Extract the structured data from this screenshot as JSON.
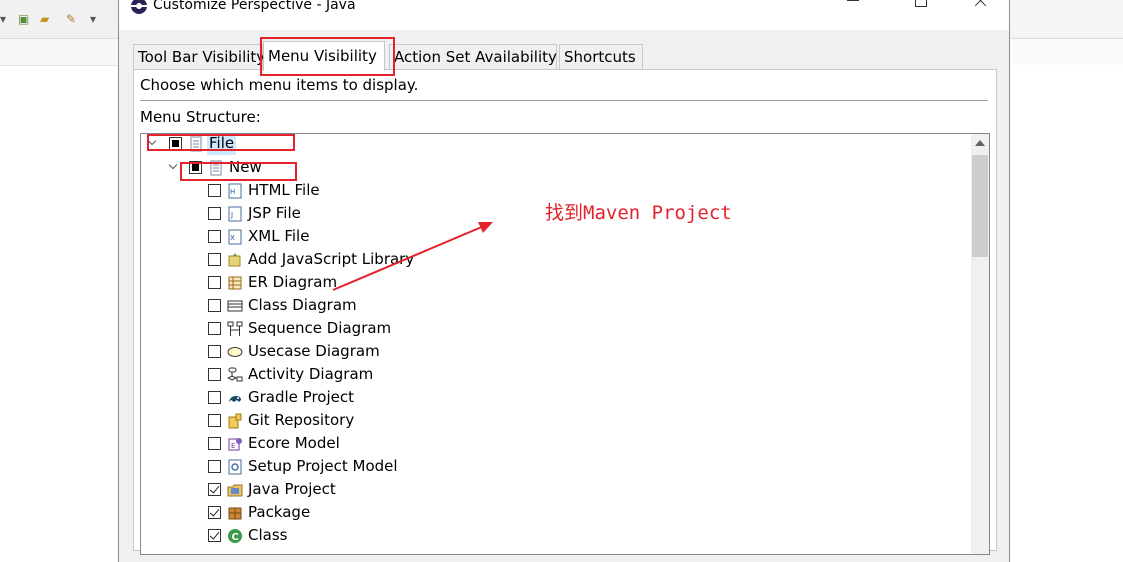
{
  "window": {
    "title": "Customize Perspective - Java"
  },
  "tabs": [
    {
      "label": "Tool Bar Visibility",
      "active": false
    },
    {
      "label": "Menu Visibility",
      "active": true
    },
    {
      "label": "Action Set Availability",
      "active": false
    },
    {
      "label": "Shortcuts",
      "active": false
    }
  ],
  "panel": {
    "description": "Choose which menu items to display.",
    "menu_structure_label": "Menu Structure:"
  },
  "tree": {
    "file": {
      "label": "File",
      "state": "partial",
      "icon": "menu-icon"
    },
    "new": {
      "label": "New",
      "state": "partial",
      "icon": "menu-icon"
    },
    "items": [
      {
        "label": "HTML File",
        "checked": false,
        "icon": "html-file-icon"
      },
      {
        "label": "JSP File",
        "checked": false,
        "icon": "jsp-file-icon"
      },
      {
        "label": "XML File",
        "checked": false,
        "icon": "xml-file-icon"
      },
      {
        "label": "Add JavaScript Library",
        "checked": false,
        "icon": "javascript-library-icon"
      },
      {
        "label": "ER Diagram",
        "checked": false,
        "icon": "er-diagram-icon"
      },
      {
        "label": "Class Diagram",
        "checked": false,
        "icon": "class-diagram-icon"
      },
      {
        "label": "Sequence Diagram",
        "checked": false,
        "icon": "sequence-diagram-icon"
      },
      {
        "label": "Usecase Diagram",
        "checked": false,
        "icon": "usecase-diagram-icon"
      },
      {
        "label": "Activity Diagram",
        "checked": false,
        "icon": "activity-diagram-icon"
      },
      {
        "label": "Gradle Project",
        "checked": false,
        "icon": "gradle-icon"
      },
      {
        "label": "Git Repository",
        "checked": false,
        "icon": "git-repository-icon"
      },
      {
        "label": "Ecore Model",
        "checked": false,
        "icon": "ecore-model-icon"
      },
      {
        "label": "Setup Project Model",
        "checked": false,
        "icon": "setup-model-icon"
      },
      {
        "label": "Java Project",
        "checked": true,
        "icon": "java-project-icon"
      },
      {
        "label": "Package",
        "checked": true,
        "icon": "package-icon"
      },
      {
        "label": "Class",
        "checked": true,
        "icon": "class-icon"
      }
    ]
  },
  "annotation": {
    "text": "找到Maven Project",
    "color": "#e3222b"
  }
}
